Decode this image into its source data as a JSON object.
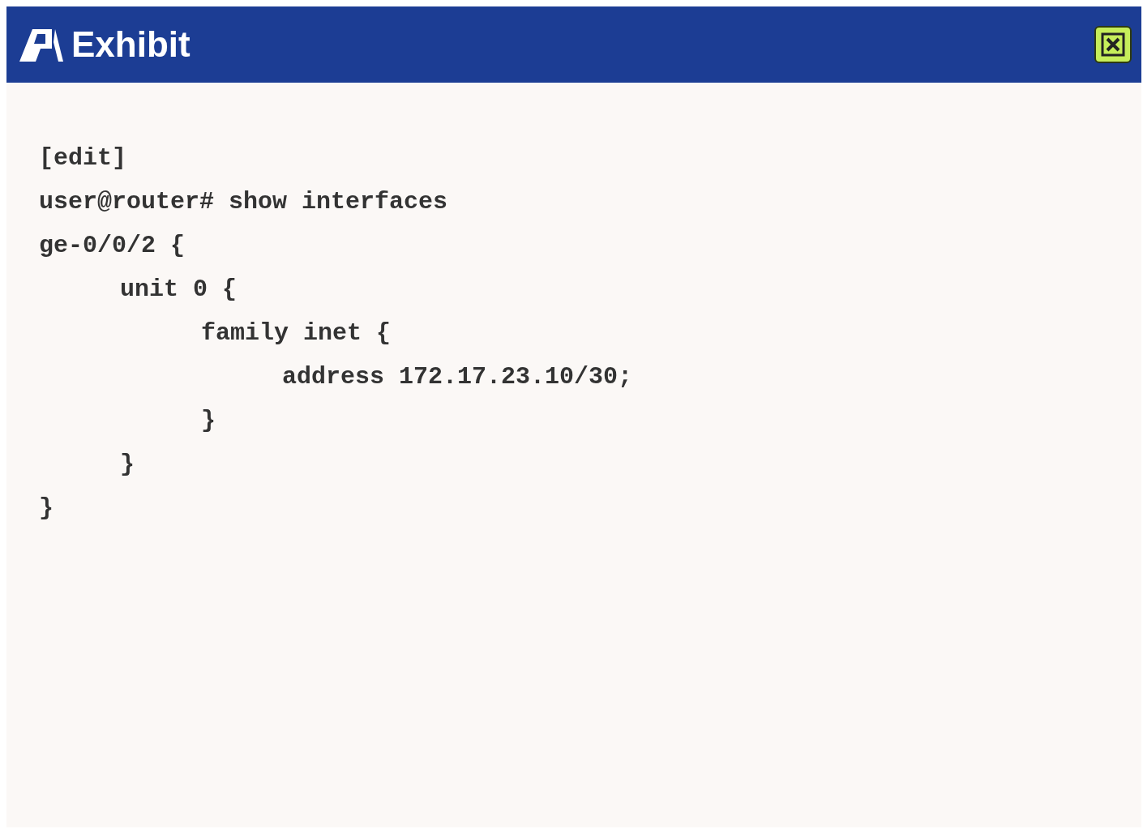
{
  "window": {
    "title": "Exhibit"
  },
  "terminal": {
    "lines": [
      "[edit]",
      "user@router# show interfaces"
    ],
    "config": [
      {
        "text": "ge-0/0/2 {",
        "close": "}",
        "children": [
          {
            "text": "unit 0 {",
            "close": "}",
            "children": [
              {
                "text": "family inet {",
                "close": "}",
                "children": [
                  {
                    "text": "address 172.17.23.10/30;"
                  }
                ]
              }
            ]
          }
        ]
      }
    ]
  }
}
